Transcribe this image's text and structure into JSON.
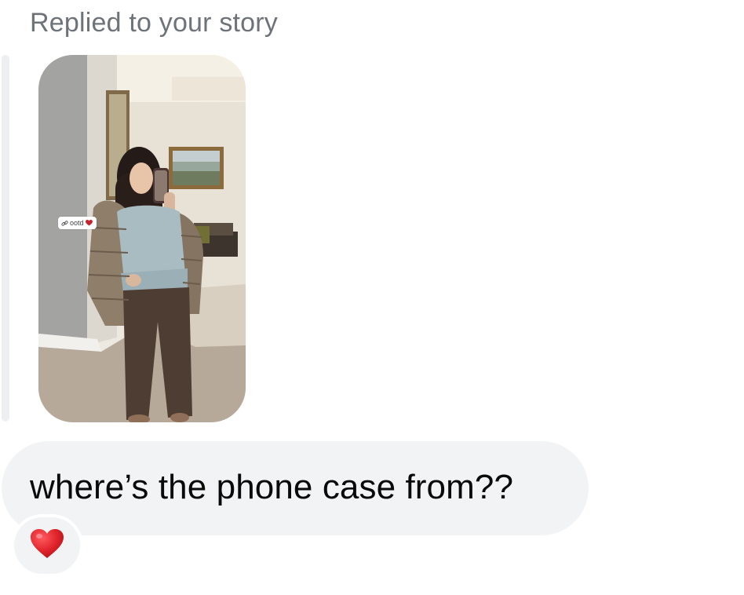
{
  "thread": {
    "reply_header": "Replied to your story",
    "story": {
      "sticker_label": "ootd",
      "sticker_link_icon": "link-icon",
      "sticker_heart_icon": "heart-icon"
    },
    "message": {
      "text": "where’s the phone case from??",
      "bubble_color": "#f2f3f5"
    },
    "reaction": {
      "emoji": "red-heart-icon",
      "color": "#e0242b"
    }
  }
}
